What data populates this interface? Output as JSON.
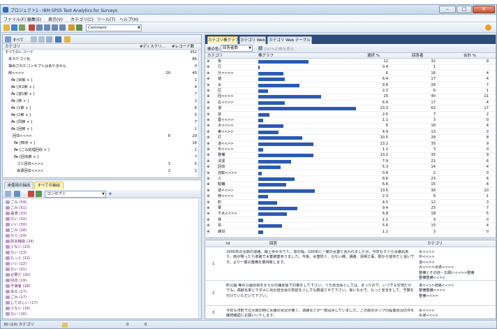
{
  "window": {
    "title": "プロジェクト1 - IBM SPSS Text Analytics for Surveys",
    "min": "–",
    "max": "□",
    "close": "✕"
  },
  "menu": [
    "ファイル(F)",
    "編集(E)",
    "表示(V)",
    "カテゴリ(C)",
    "ツール(T)",
    "ヘルプ(H)"
  ],
  "toolbar": {
    "combo_value": "Comment"
  },
  "category_panel": {
    "filter_label": "すべて",
    "headers": [
      "カテゴリ",
      "#ディスクリ...",
      "#レコード数"
    ],
    "rows": [
      {
        "label": "すべてのレコード",
        "d": "",
        "r": "352"
      },
      {
        "label": "未カテゴリ化",
        "d": "",
        "r": "86"
      },
      {
        "label": "抽出されたコンセプトはありません",
        "d": "",
        "r": "0"
      },
      {
        "label": "節<<>>",
        "d": "20",
        "r": "40"
      },
      {
        "label": "[目帳 + ]",
        "d": "",
        "r": "1"
      },
      {
        "label": "[弁2節 + ]",
        "d": "",
        "r": "4"
      },
      {
        "label": "[道1節 + ]",
        "d": "",
        "r": "7"
      },
      {
        "label": "[節 + ]",
        "d": "",
        "r": "2"
      },
      {
        "label": "[1節 + ]",
        "d": "",
        "r": "6"
      },
      {
        "label": "[2節 + ]",
        "d": "",
        "r": "5"
      },
      {
        "label": "[同節 + ]",
        "d": "",
        "r": "7"
      },
      {
        "label": "[回節 + ]",
        "d": "",
        "r": "1"
      },
      {
        "label": "回収<<>>",
        "d": "8",
        "r": "29"
      },
      {
        "label": "[節収 + ]",
        "d": "",
        "r": "16"
      },
      {
        "label": "[ごみ処理回収 + ]",
        "d": "",
        "r": "1"
      },
      {
        "label": "[回収節 + ]",
        "d": "",
        "r": "7"
      },
      {
        "label": "ゴミ回収<<>>",
        "d": "3",
        "r": "5"
      },
      {
        "label": "資源回収<<>>",
        "d": "2",
        "r": "2"
      }
    ]
  },
  "lower_left": {
    "tabs": [
      "未使用の抽出",
      "すべての抽出"
    ],
    "combo": "コンセプト",
    "concepts": [
      "ごみ (59)",
      "ごみ (51)",
      "最適 (33)",
      "ない (32)",
      "いい (30)",
      "ごみ (28)",
      "なら (24)",
      "助言機能 (24)",
      "少ない (23)",
      "ない (23)",
      "もっと (22)",
      "いい (22)",
      "ない (21)",
      "必要だ (20)",
      "回収 (19)",
      "不満者 (18)",
      "ある (17)",
      "ごみ (17)",
      "してほしい (17)",
      "少ない (16)",
      "ない (16)"
    ]
  },
  "right_panel": {
    "tabs": [
      "カテゴリ棒グラフ",
      "カテゴリ Web",
      "カテゴリ Web テーブル"
    ],
    "sort_label": "棒の色:",
    "sort_combo": "回答者数",
    "checkbox_label": "100%の棒を表示",
    "headers": [
      "カテゴリ",
      "棒グラフ",
      "選択 %",
      "回答者",
      "合計 %"
    ]
  },
  "chart_data": {
    "type": "table",
    "columns": [
      "カテゴリ",
      "選択 %",
      "回答者",
      "合計 %"
    ],
    "rows": [
      {
        "category": "条",
        "sel": 12.0,
        "n": 32,
        "total": 9
      },
      {
        "category": "行",
        "sel": 0.4,
        "n": 1,
        "n_total": 0
      },
      {
        "category": "分<<>>",
        "sel": 6.0,
        "n": 16,
        "total": 4
      },
      {
        "category": "値",
        "sel": 6.4,
        "n": 17,
        "total": 4
      },
      {
        "category": "水",
        "sel": 9.8,
        "n": 26,
        "total": 7
      },
      {
        "category": "区",
        "sel": 2.3,
        "n": 6,
        "total": 1
      },
      {
        "category": "回<<>>",
        "sel": 15.0,
        "n": 40,
        "total": 11
      },
      {
        "category": "広<<>>",
        "sel": 6.4,
        "n": 17,
        "total": 4
      },
      {
        "category": "道",
        "sel": 23.3,
        "n": 62,
        "total": 17
      },
      {
        "category": "窓",
        "sel": 2.6,
        "n": 7,
        "total": 2
      },
      {
        "category": "屋<<>>",
        "sel": 1.1,
        "n": 3,
        "total": 0
      },
      {
        "category": "大<<>>",
        "sel": 6.0,
        "n": 16,
        "total": 4
      },
      {
        "category": "東<<>>",
        "sel": 4.9,
        "n": 13,
        "total": 3
      },
      {
        "category": "打",
        "sel": 10.5,
        "n": 28,
        "total": 8
      },
      {
        "category": "道<<>>",
        "sel": 13.2,
        "n": 35,
        "total": 9
      },
      {
        "category": "中<<>>",
        "sel": 1.1,
        "n": 3,
        "total": 0
      },
      {
        "category": "整備",
        "sel": 13.2,
        "n": 35,
        "total": 9
      },
      {
        "category": "清潔",
        "sel": 7.9,
        "n": 21,
        "total": 6
      },
      {
        "category": "回収",
        "sel": 5.3,
        "n": 14,
        "total": 4
      },
      {
        "category": "自転<<>>",
        "sel": 0.8,
        "n": 2,
        "total": 0
      },
      {
        "category": "人",
        "sel": 8.6,
        "n": 23,
        "total": 6
      },
      {
        "category": "駐輪",
        "sel": 6.6,
        "n": 15,
        "total": 4
      },
      {
        "category": "道<<>>",
        "sel": 13.5,
        "n": 36,
        "total": 10
      },
      {
        "category": "雨<<>>",
        "sel": 2.3,
        "n": 6,
        "total": 1
      },
      {
        "category": "町",
        "sel": 4.5,
        "n": 12,
        "total": 3
      },
      {
        "category": "軍",
        "sel": 9.4,
        "n": 25,
        "total": 7
      },
      {
        "category": "下水<<>>",
        "sel": 6.8,
        "n": 18,
        "total": 5
      },
      {
        "category": "林",
        "sel": 1.1,
        "n": 3,
        "total": 0
      },
      {
        "category": "鳥",
        "sel": 5.6,
        "n": 15,
        "total": 4
      },
      {
        "category": "縁切",
        "sel": 1.1,
        "n": 3,
        "total": 0
      }
    ]
  },
  "records": {
    "headers": [
      "Id",
      "回答",
      "カテゴリ"
    ],
    "items": [
      {
        "id": "1",
        "text": "2000年の北側の道路。線上歩かせてた。道の幅、100年に一度の水害と言われましたが、今年もすぐら水路出あり、雨が降ったら道路で水害被害ありました。今後、水害防ぐ、もない様。通路、清掃工事、駅から徒歩だと遠いです。より一層の整備を期待致します。",
        "cats": "水<<>>\n中<<>>\n道<<>>\n大<<>>水道<<>>\n整備とその他・お願い<<>>整備\n整備整備<<>>"
      },
      {
        "id": "2",
        "text": "町公園 等の公園出資をからかの補助金で対策をして下さい。うち自治会としては、まったので、いつでも空地だけでも。高齢化率と下ダメに出の自治会の負担を少しでも軽減させて下さい。良いなかで、もっと安全をして、予算を付けていただいて下さい。",
        "cats": "道<<>>道路<<>>\n整備整備<<>>\n整備<<>>"
      },
      {
        "id": "3",
        "text": "今年も市町での大雨の時に水路の状況が悪く、道路などが一部冠水していました。この前のポンプの設置状況の件を継続確認にお願いいたします。",
        "cats": "水<<>>\n水道<<>>"
      }
    ]
  },
  "status": {
    "left": "30 (10) カテゴリ",
    "mid1": "0",
    "mid2": "0"
  },
  "colors": {
    "bar": "#2a5ab3",
    "accent": "#2d6db5",
    "highlight": "#ffee66",
    "concept": "#6c1d7a"
  }
}
